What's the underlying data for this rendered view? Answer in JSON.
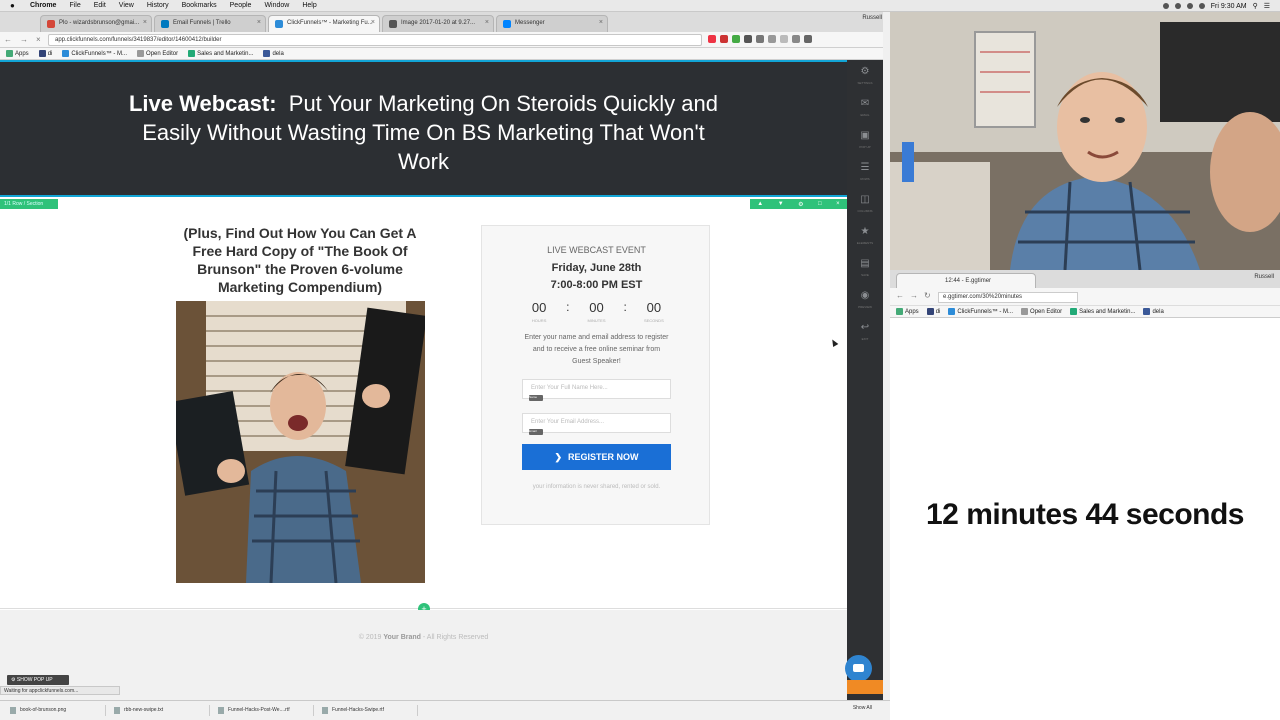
{
  "menubar": {
    "app": "Chrome",
    "items": [
      "File",
      "Edit",
      "View",
      "History",
      "Bookmarks",
      "People",
      "Window",
      "Help"
    ],
    "clock": "Fri 9:30 AM"
  },
  "browser": {
    "tabs": [
      {
        "label": "Plo - wizardsbrunson@gmai...",
        "color": "#d44638"
      },
      {
        "label": "Email Funnels | Trello",
        "color": "#0079bf"
      },
      {
        "label": "ClickFunnels™ - Marketing Fu...",
        "color": "#2d8cd8"
      },
      {
        "label": "Image 2017-01-20 at 9.27...",
        "color": "#555555"
      },
      {
        "label": "Messenger",
        "color": "#0084ff"
      }
    ],
    "user": "Russell",
    "url": "app.clickfunnels.com/funnels/3419837/editor/14600412/builder",
    "bookmarks": [
      "Apps",
      "di",
      "ClickFunnels™ - M...",
      "Open Editor",
      "Sales and Marketin...",
      "dela"
    ]
  },
  "landing": {
    "headline_bold": "Live Webcast:",
    "headline_rest": "Put Your Marketing On Steroids Quickly and Easily Without Wasting Time On BS Marketing That Won't Work",
    "section_tag": "1/1 Row / Section",
    "subheadline": "(Plus, Find Out How You Can Get A Free Hard Copy of \"The Book Of Brunson\" the Proven 6-volume Marketing Compendium)",
    "event_label": "LIVE WEBCAST EVENT",
    "event_date": "Friday, June 28th",
    "event_time": "7:00-8:00 PM EST",
    "countdown": {
      "hours": "00",
      "minutes": "00",
      "seconds": "00",
      "hours_label": "HOURS",
      "minutes_label": "MINUTES",
      "seconds_label": "SECONDS"
    },
    "instructions": "Enter your name and email address to register and to receive a free online seminar from Guest Speaker!",
    "name_placeholder": "Enter Your Full Name Here...",
    "email_placeholder": "Enter Your Email Address...",
    "field_tag": "Name",
    "field_tag_email": "Email",
    "register_label": "REGISTER NOW",
    "privacy": "your information is never shared, rented or sold.",
    "copyright_pre": "© 2019",
    "copyright_brand": "Your Brand",
    "copyright_post": "- All Rights Reserved",
    "show_popup": "SHOW POP UP",
    "status": "Waiting for appclickfunnels.com..."
  },
  "editor_panel": [
    "SETTINGS",
    "EMAIL",
    "POP UP",
    "ROWS",
    "COLUMNS",
    "ELEMENTS",
    "SAVE",
    "PREVIEW",
    "EXIT"
  ],
  "downloads": [
    {
      "file": "book-of-brunson.png"
    },
    {
      "file": "rbb-new-swipe.txt"
    },
    {
      "file": "Funnel-Hacks-Post-We....rtf"
    },
    {
      "file": "Funnel-Hacks-Swipe.rtf"
    }
  ],
  "downloads_show_all": "Show All",
  "timer_window": {
    "tab": "12:44 - E.ggtimer",
    "user": "Russell",
    "url": "e.ggtimer.com/30%20minutes",
    "bookmarks": [
      "Apps",
      "di",
      "ClickFunnels™ - M...",
      "Open Editor",
      "Sales and Marketin...",
      "dela"
    ],
    "timer_text": "12 minutes 44 seconds"
  },
  "colors": {
    "hero_bg": "#2c2f33",
    "accent": "#12a5d6",
    "button": "#1a6fd6",
    "editor_green": "#2fc27a",
    "panel": "#2e3033"
  }
}
